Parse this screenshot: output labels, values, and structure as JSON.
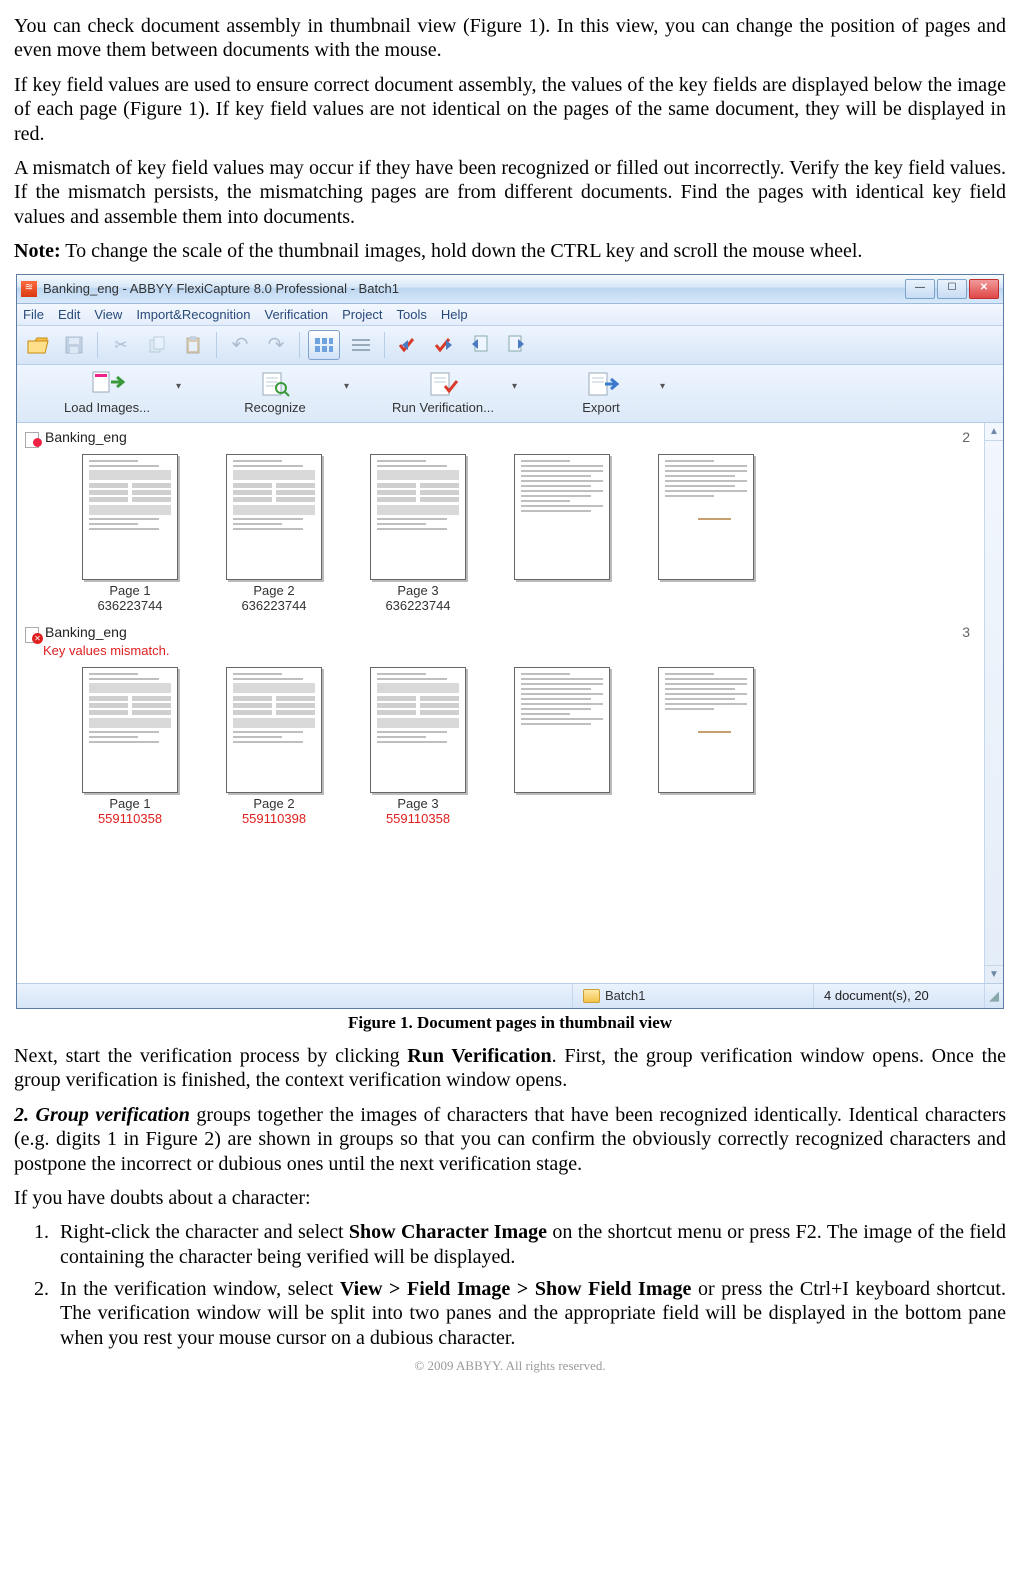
{
  "para1": "You can check document assembly in thumbnail view (Figure 1). In this view, you can change the position of pages and even move them between documents with the mouse.",
  "para2": "If key field values are used to ensure correct document assembly, the values of the key fields are displayed below the image of each page (Figure 1). If key field values are not identical on the pages of the same document, they will be displayed in red.",
  "para3": "A mismatch of key field values may occur if they have been recognized or filled out incorrectly. Verify the key field values. If the mismatch persists, the mismatching pages are from different documents. Find the pages with identical key field values and assemble them into documents.",
  "noteLabel": "Note:",
  "noteText": " To change the scale of the thumbnail images, hold down the CTRL key and scroll the mouse wheel.",
  "caption1": "Figure 1. Document pages in thumbnail view",
  "para4a": "Next, start the verification process by clicking ",
  "para4bold": "Run Verification",
  "para4b": ". First, the group verification window opens. Once the group verification is finished, the context verification window opens.",
  "gvLabel": "2. Group verification",
  "gvText": " groups together the images of characters that have been recognized identically. Identical characters (e.g. digits 1 in Figure 2) are shown in groups so that you can confirm the obviously correctly recognized characters and postpone the incorrect or dubious ones until the next verification stage.",
  "doubts": "If you have doubts about a character:",
  "li1a": "Right-click the character and select ",
  "li1bold": "Show Character Image",
  "li1b": " on the shortcut menu or press F2. The image of the field containing the character being verified will be displayed.",
  "li2a": "In the verification window, select ",
  "li2bold": "View > Field Image > Show Field Image",
  "li2b": " or press the Ctrl+I keyboard shortcut. The verification window will be split into two panes and the appropriate field will be displayed in the bottom pane when you rest your mouse cursor on a dubious character.",
  "footer": "© 2009 ABBYY. All rights reserved.",
  "app": {
    "title": "Banking_eng - ABBYY FlexiCapture 8.0 Professional - Batch1",
    "menus": [
      "File",
      "Edit",
      "View",
      "Import&Recognition",
      "Verification",
      "Project",
      "Tools",
      "Help"
    ],
    "big": {
      "load": "Load Images...",
      "recognize": "Recognize",
      "runverif": "Run Verification...",
      "export": "Export"
    },
    "doc1": {
      "name": "Banking_eng",
      "count": "2",
      "pages": [
        {
          "label": "Page 1",
          "key": "636223744"
        },
        {
          "label": "Page 2",
          "key": "636223744"
        },
        {
          "label": "Page 3",
          "key": "636223744"
        }
      ]
    },
    "doc2": {
      "name": "Banking_eng",
      "count": "3",
      "mismatch": "Key values mismatch.",
      "pages": [
        {
          "label": "Page 1",
          "key": "559110358"
        },
        {
          "label": "Page 2",
          "key": "559110398"
        },
        {
          "label": "Page 3",
          "key": "559110358"
        }
      ]
    },
    "status": {
      "batch": "Batch1",
      "count": "4 document(s), 20"
    }
  }
}
